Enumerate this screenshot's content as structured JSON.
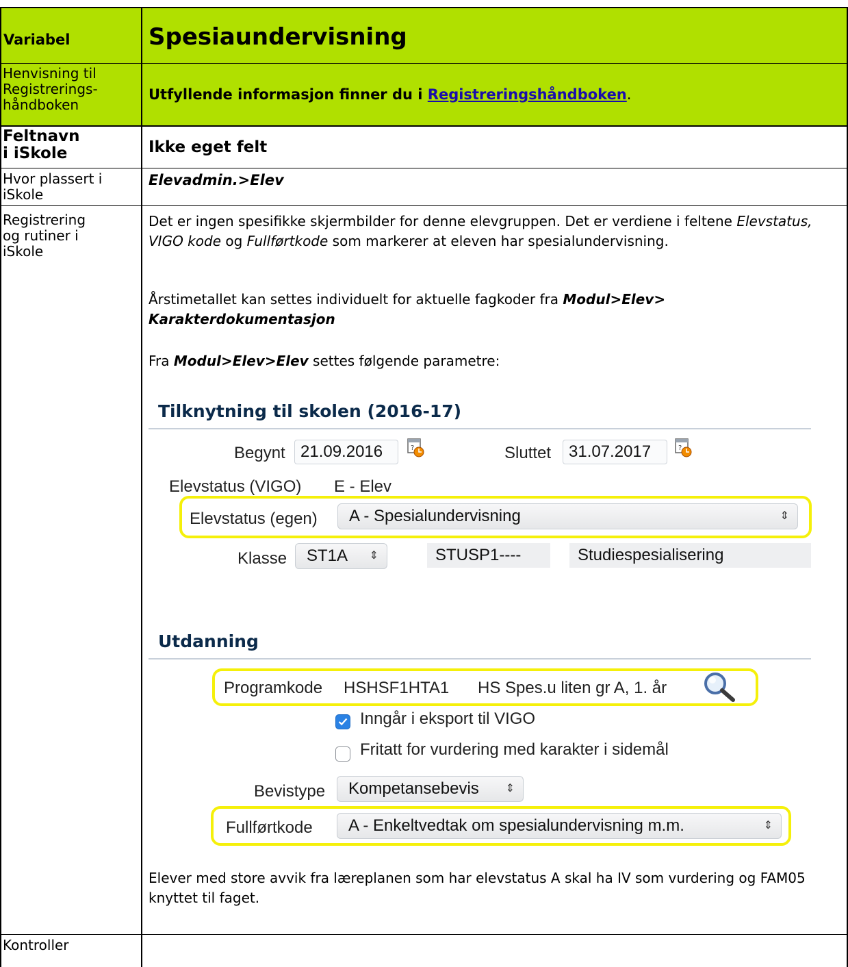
{
  "header": {
    "variable_label": "Variabel",
    "title": "Spesiaundervisning"
  },
  "rows": {
    "henvisning": {
      "label": "Henvisning til Registrerings-håndboken",
      "label_lines": [
        "Henvisning til",
        "Registrerings-",
        "håndboken"
      ],
      "text_prefix": "Utfyllende informasjon finner du i ",
      "link_text": "Registreringshåndboken",
      "text_suffix": "."
    },
    "feltnavn": {
      "label_lines": [
        "Feltnavn",
        "i iSkole"
      ],
      "value": "Ikke eget felt"
    },
    "hvor": {
      "label_lines": [
        "Hvor plassert i",
        "iSkole"
      ],
      "value": "Elevadmin.>Elev"
    },
    "registrering": {
      "label_lines": [
        "Registrering",
        "og rutiner i",
        "iSkole"
      ],
      "p1_a": "Det er ingen spesifikke skjermbilder for denne elevgruppen. Det er verdiene i feltene ",
      "p1_it1": "Elevstatus, VIGO kode",
      "p1_b": " og ",
      "p1_it2": "Fullførtkode",
      "p1_c": " som markerer at eleven har spesialundervisning.",
      "p2_a": "Årstimetallet kan settes individuelt for aktuelle fagkoder fra ",
      "p2_bi1": "Modul>Elev>",
      "p2_bi2": "Karakterdokumentasjon",
      "p3_a": "Fra ",
      "p3_bi": "Modul>Elev>Elev",
      "p3_b": " settes følgende parametre:",
      "p4": "Elever med store avvik fra læreplanen som har elevstatus A skal ha IV som vurdering og FAM05 knyttet til faget."
    },
    "kontroller": {
      "label": "Kontroller"
    }
  },
  "screenshot": {
    "section1_title": "Tilknytning til skolen (2016-17)",
    "begynt_label": "Begynt",
    "begynt_value": "21.09.2016",
    "sluttet_label": "Sluttet",
    "sluttet_value": "31.07.2017",
    "elevstatus_vigo_label": "Elevstatus (VIGO)",
    "elevstatus_vigo_value": "E - Elev",
    "elevstatus_egen_label": "Elevstatus (egen)",
    "elevstatus_egen_value": "A - Spesialundervisning",
    "klasse_label": "Klasse",
    "klasse_value": "ST1A",
    "klasse_code": "STUSP1----",
    "klasse_name": "Studiespesialisering",
    "section2_title": "Utdanning",
    "programkode_label": "Programkode",
    "programkode_value": "HSHSF1HTA1",
    "programkode_desc": "HS Spes.u liten gr A, 1. år",
    "checkbox1_label": "Inngår i eksport til VIGO",
    "checkbox1_checked": true,
    "checkbox2_label": "Fritatt for vurdering med karakter i sidemål",
    "checkbox2_checked": false,
    "bevistype_label": "Bevistype",
    "bevistype_value": "Kompetansebevis",
    "fullfort_label": "Fullførtkode",
    "fullfort_value": "A - Enkeltvedtak om spesialundervisning m.m.",
    "select_arrows": "⇕",
    "highlight_color": "#f5f00a",
    "header_green": "#b0e000"
  }
}
